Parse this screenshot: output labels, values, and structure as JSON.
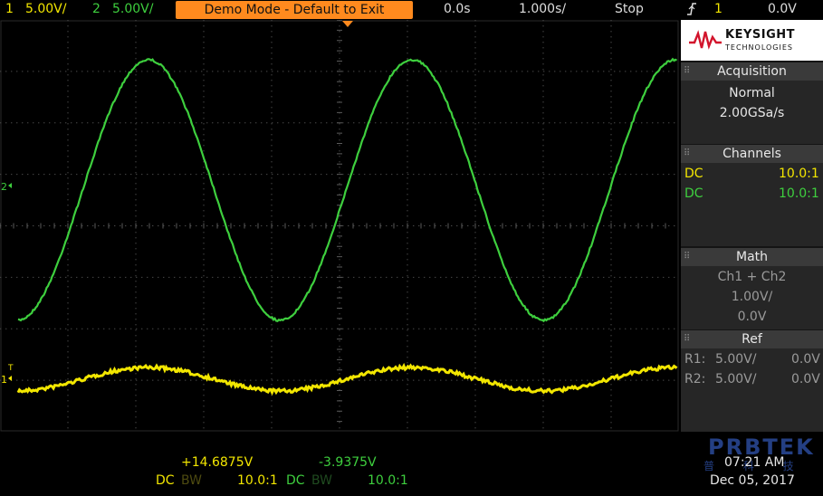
{
  "top_bar": {
    "ch1_num": "1",
    "ch1_scale": "5.00V/",
    "ch2_num": "2",
    "ch2_scale": "5.00V/",
    "demo_banner": "Demo Mode - Default to Exit",
    "time_offset": "0.0s",
    "time_scale": "1.000s/",
    "run_state": "Stop",
    "trigger_icon": "trigger-edge-icon",
    "trigger_source": "1",
    "trigger_level": "0.0V"
  },
  "logo": {
    "name": "KEYSIGHT",
    "sub": "TECHNOLOGIES"
  },
  "acquisition": {
    "title": "Acquisition",
    "mode": "Normal",
    "rate": "2.00GSa/s"
  },
  "channels": {
    "title": "Channels",
    "rows": [
      {
        "coupling": "DC",
        "probe": "10.0:1"
      },
      {
        "coupling": "DC",
        "probe": "10.0:1"
      }
    ]
  },
  "math": {
    "title": "Math",
    "func": "Ch1 + Ch2",
    "scale": "1.00V/",
    "offset": "0.0V"
  },
  "ref": {
    "title": "Ref",
    "rows": [
      {
        "label": "R1:",
        "scale": "5.00V/",
        "offset": "0.0V"
      },
      {
        "label": "R2:",
        "scale": "5.00V/",
        "offset": "0.0V"
      }
    ]
  },
  "markers": {
    "ch2": "2",
    "ch1": "1",
    "trig": "T"
  },
  "bottom": {
    "ch1_value": "+14.6875V",
    "ch2_value": "-3.9375V",
    "ch1_coupling": "DC",
    "ch1_bw": "BW",
    "ch1_probe": "10.0:1",
    "ch2_coupling": "DC",
    "ch2_bw": "BW",
    "ch2_probe": "10.0:1",
    "time": "07:21 AM",
    "date": "Dec 05, 2017"
  },
  "watermark": {
    "text": "PRBTEK",
    "sub": "普 科 技"
  },
  "colors": {
    "ch1": "#f2e600",
    "ch2": "#3ecf3e",
    "banner": "#ff8a1e"
  }
}
